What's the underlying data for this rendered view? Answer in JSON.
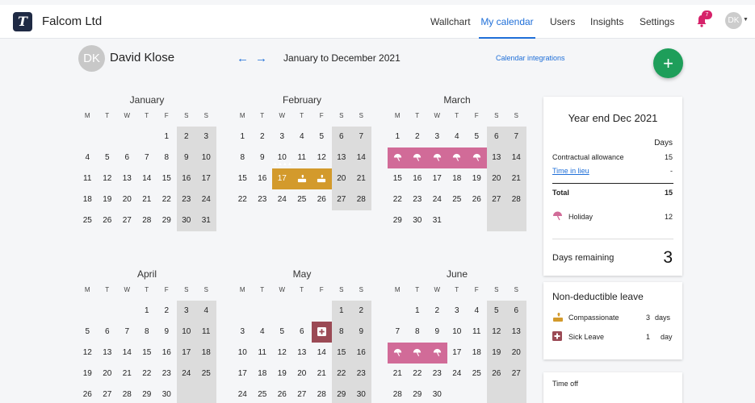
{
  "header": {
    "logo_letter": "T",
    "company": "Falcom Ltd",
    "nav": [
      "Wallchart",
      "My calendar",
      "Users",
      "Insights",
      "Settings"
    ],
    "active_nav": "My calendar",
    "notif_count": "7",
    "avatar_initials": "DK"
  },
  "toolbar": {
    "avatar_initials": "DK",
    "person_name": "David Klose",
    "prev_icon": "←",
    "next_icon": "→",
    "range_label": "January to December 2021",
    "integrations_link": "Calendar integrations",
    "add_icon": "+"
  },
  "calendar": {
    "dow": [
      "M",
      "T",
      "W",
      "T",
      "F",
      "S",
      "S"
    ],
    "months": [
      {
        "name": "January",
        "weeks": [
          [
            "",
            "",
            "",
            "",
            "1",
            "2",
            "3"
          ],
          [
            "4",
            "5",
            "6",
            "7",
            "8",
            "9",
            "10"
          ],
          [
            "11",
            "12",
            "13",
            "14",
            "15",
            "16",
            "17"
          ],
          [
            "18",
            "19",
            "20",
            "21",
            "22",
            "23",
            "24"
          ],
          [
            "25",
            "26",
            "27",
            "28",
            "29",
            "30",
            "31"
          ]
        ]
      },
      {
        "name": "February",
        "weeks": [
          [
            "1",
            "2",
            "3",
            "4",
            "5",
            "6",
            "7"
          ],
          [
            "8",
            "9",
            "10",
            "11",
            "12",
            "13",
            "14"
          ],
          [
            "15",
            "16",
            "17",
            "18",
            "19",
            "20",
            "21"
          ],
          [
            "22",
            "23",
            "24",
            "25",
            "26",
            "27",
            "28"
          ]
        ]
      },
      {
        "name": "March",
        "weeks": [
          [
            "1",
            "2",
            "3",
            "4",
            "5",
            "6",
            "7"
          ],
          [
            "8",
            "9",
            "10",
            "11",
            "12",
            "13",
            "14"
          ],
          [
            "15",
            "16",
            "17",
            "18",
            "19",
            "20",
            "21"
          ],
          [
            "22",
            "23",
            "24",
            "25",
            "26",
            "27",
            "28"
          ],
          [
            "29",
            "30",
            "31",
            "",
            "",
            "",
            ""
          ]
        ]
      },
      {
        "name": "April",
        "weeks": [
          [
            "",
            "",
            "",
            "1",
            "2",
            "3",
            "4"
          ],
          [
            "5",
            "6",
            "7",
            "8",
            "9",
            "10",
            "11"
          ],
          [
            "12",
            "13",
            "14",
            "15",
            "16",
            "17",
            "18"
          ],
          [
            "19",
            "20",
            "21",
            "22",
            "23",
            "24",
            "25"
          ],
          [
            "26",
            "27",
            "28",
            "29",
            "30",
            "",
            ""
          ]
        ]
      },
      {
        "name": "May",
        "weeks": [
          [
            "",
            "",
            "",
            "",
            "",
            "1",
            "2"
          ],
          [
            "3",
            "4",
            "5",
            "6",
            "7",
            "8",
            "9"
          ],
          [
            "10",
            "11",
            "12",
            "13",
            "14",
            "15",
            "16"
          ],
          [
            "17",
            "18",
            "19",
            "20",
            "21",
            "22",
            "23"
          ],
          [
            "24",
            "25",
            "26",
            "27",
            "28",
            "29",
            "30"
          ]
        ]
      },
      {
        "name": "June",
        "weeks": [
          [
            "",
            "1",
            "2",
            "3",
            "4",
            "5",
            "6"
          ],
          [
            "7",
            "8",
            "9",
            "10",
            "11",
            "12",
            "13"
          ],
          [
            "14",
            "15",
            "16",
            "17",
            "18",
            "19",
            "20"
          ],
          [
            "21",
            "22",
            "23",
            "24",
            "25",
            "26",
            "27"
          ],
          [
            "28",
            "29",
            "30",
            "",
            "",
            "",
            ""
          ]
        ]
      }
    ],
    "events": [
      {
        "month": "February",
        "days": [
          "17",
          "18",
          "19"
        ],
        "type": "compassionate",
        "color": "#d39a2c"
      },
      {
        "month": "March",
        "days": [
          "8",
          "9",
          "10",
          "11",
          "12"
        ],
        "type": "holiday",
        "color": "#d16b98"
      },
      {
        "month": "May",
        "days": [
          "7"
        ],
        "type": "sick",
        "color": "#9b4a55"
      },
      {
        "month": "June",
        "days": [
          "14",
          "15",
          "16"
        ],
        "type": "holiday",
        "color": "#d16b98"
      }
    ]
  },
  "summary": {
    "title": "Year end Dec 2021",
    "days_header": "Days",
    "rows": [
      {
        "label": "Contractual allowance",
        "value": "15"
      },
      {
        "label": "Time in lieu",
        "value": "-"
      }
    ],
    "total_label": "Total",
    "total_value": "15",
    "holiday_label": "Holiday",
    "holiday_value": "12",
    "remaining_label": "Days remaining",
    "remaining_value": "3"
  },
  "non_deductible": {
    "title": "Non-deductible leave",
    "items": [
      {
        "label": "Compassionate",
        "count": "3",
        "unit": "days",
        "icon": "compassionate-icon"
      },
      {
        "label": "Sick Leave",
        "count": "1",
        "unit": "day",
        "icon": "sick-icon"
      }
    ]
  },
  "time_off": {
    "title": "Time off"
  },
  "colors": {
    "accent": "#1f6fd8",
    "add_button": "#1e9e5a",
    "holiday": "#d16b98",
    "compassionate": "#d39a2c",
    "sick": "#9b4a55",
    "badge": "#d6226a"
  }
}
